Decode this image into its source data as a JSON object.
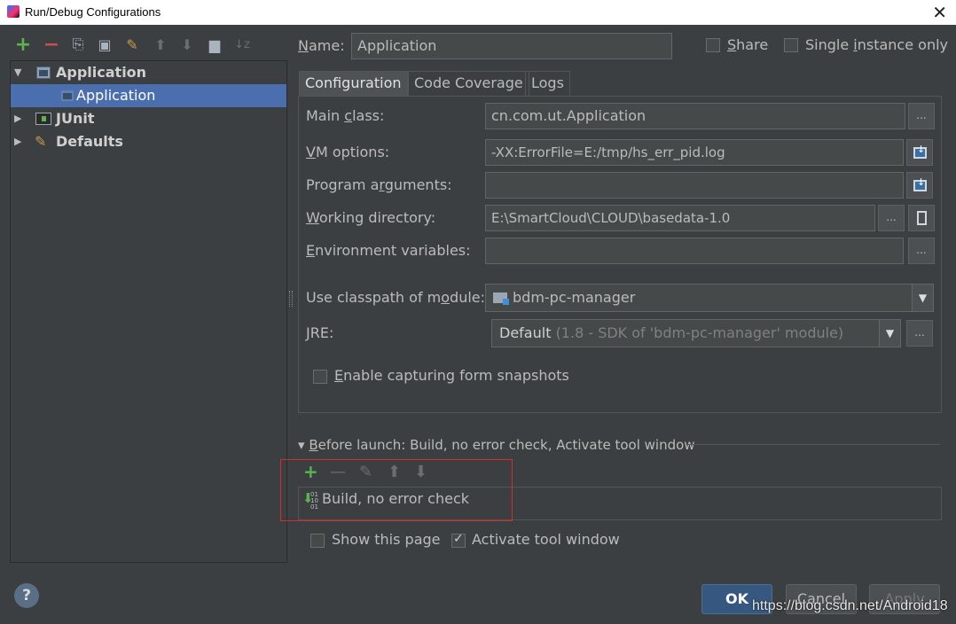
{
  "window": {
    "title": "Run/Debug Configurations",
    "close_glyph": "✕"
  },
  "toolbar": {
    "add": "+",
    "remove": "−",
    "copy": "⎘",
    "save": "▣",
    "edit_defaults": "✎",
    "move_up": "⬆",
    "move_down": "⬇",
    "folder": "▆",
    "sort": "↓z"
  },
  "tree": {
    "items": [
      {
        "label": "Application",
        "expanded": true,
        "bold": true
      },
      {
        "label": "Application",
        "selected": true
      },
      {
        "label": "JUnit",
        "expanded": false,
        "bold": true
      },
      {
        "label": "Defaults",
        "expanded": false,
        "bold": true
      }
    ],
    "arrow_expanded": "▼",
    "arrow_collapsed": "▶"
  },
  "name": {
    "label_prefix": "",
    "label_u": "N",
    "label_rest": "ame:",
    "value": "Application"
  },
  "share": {
    "label_u": "S",
    "label_rest": "hare",
    "checked": false
  },
  "single_instance": {
    "label_a": "Single ",
    "label_u": "i",
    "label_rest": "nstance only",
    "checked": false
  },
  "tabs": [
    {
      "label": "Configuration",
      "active": true
    },
    {
      "label": "Code Coverage",
      "active": false
    },
    {
      "label": "Logs",
      "active": false
    }
  ],
  "config": {
    "main_class": {
      "label_a": "Main ",
      "label_u": "c",
      "label_rest": "lass:",
      "value": "cn.com.ut.Application"
    },
    "vm_options": {
      "label_u": "V",
      "label_rest": "M options:",
      "value": "-XX:ErrorFile=E:/tmp/hs_err_pid.log"
    },
    "program_args": {
      "label_a": "Program a",
      "label_u": "r",
      "label_rest": "guments:",
      "value": ""
    },
    "working_dir": {
      "label_u": "W",
      "label_rest": "orking directory:",
      "value": "E:\\SmartCloud\\CLOUD\\basedata-1.0"
    },
    "env_vars": {
      "label_u": "E",
      "label_rest": "nvironment variables:",
      "value": ""
    },
    "classpath": {
      "label_a": "Use classpath of m",
      "label_u": "o",
      "label_rest": "dule:",
      "value": "bdm-pc-manager"
    },
    "jre": {
      "label_u": "J",
      "label_rest": "RE:",
      "value_main": "Default",
      "value_hint": "(1.8 - SDK of 'bdm-pc-manager' module)"
    },
    "snapshots": {
      "label_u": "E",
      "label_rest": "nable capturing form snapshots",
      "checked": false
    },
    "dots": "...",
    "dropdown_glyph": "▼"
  },
  "before_launch": {
    "title_arrow": "▾",
    "title_u": "B",
    "title_rest": "efore launch: Build, no error check, Activate tool window",
    "tools": {
      "add": "+",
      "remove": "—",
      "edit": "✎",
      "up": "⬆",
      "down": "⬇"
    },
    "items": [
      {
        "label": "Build, no error check",
        "icon_glyph": "⬇"
      }
    ]
  },
  "show_page": {
    "label": "Show this page",
    "checked": false
  },
  "activate_tool": {
    "label": "Activate tool window",
    "checked": true
  },
  "buttons": {
    "ok": "OK",
    "cancel": "Cancel",
    "apply": "Apply",
    "help": "?"
  },
  "watermark": "https://blog.csdn.net/Android18",
  "colors": {
    "accent": "#4b6eaf",
    "ok_button": "#365880",
    "highlight_box": "#d62b2b",
    "add_green": "#5fb34f",
    "remove_red": "#c94f4f"
  }
}
